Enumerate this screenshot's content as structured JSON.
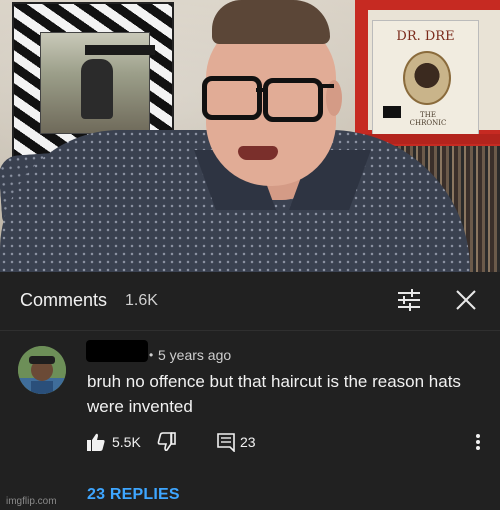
{
  "header": {
    "title": "Comments",
    "count": "1.6K"
  },
  "comment": {
    "dot": "•",
    "time": "5 years ago",
    "text": "bruh no offence but that haircut is the reason hats were invented",
    "likes": "5.5K",
    "replies_count": "23"
  },
  "replies_link": "23 REPLIES",
  "album": {
    "title": "DR. DRE",
    "subtitle": "THE CHRONIC"
  },
  "watermark": "imgflip.com",
  "icons": {
    "filter": "filter-sliders-icon",
    "close": "close-icon",
    "like": "thumbs-up-icon",
    "dislike": "thumbs-down-icon",
    "reply": "reply-comment-icon",
    "more": "more-vertical-icon"
  },
  "colors": {
    "panel_bg": "#212121",
    "link": "#3ea6ff",
    "text": "#f1f1f1",
    "muted": "#cfcfcf"
  }
}
